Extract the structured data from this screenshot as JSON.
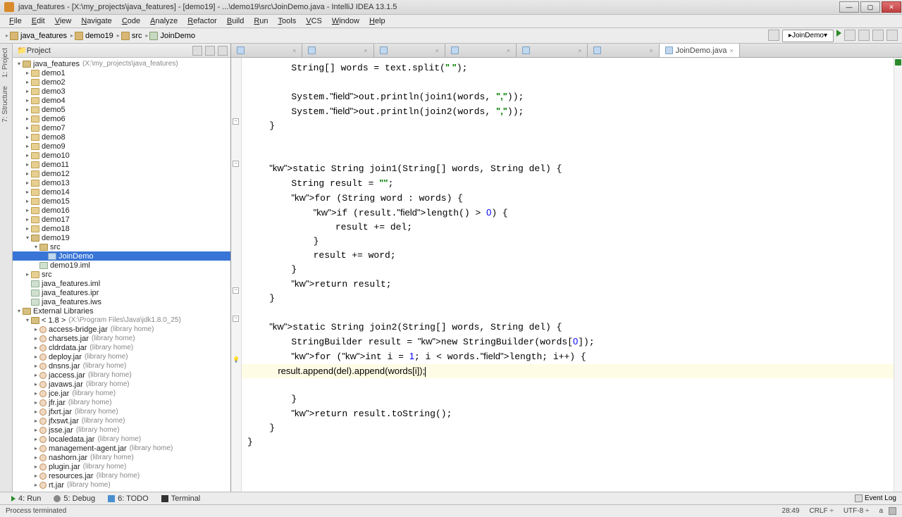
{
  "title": "java_features - [X:\\my_projects\\java_features] - [demo19] - ...\\demo19\\src\\JoinDemo.java - IntelliJ IDEA 13.1.5",
  "menu": [
    "File",
    "Edit",
    "View",
    "Navigate",
    "Code",
    "Analyze",
    "Refactor",
    "Build",
    "Run",
    "Tools",
    "VCS",
    "Window",
    "Help"
  ],
  "breadcrumb": [
    {
      "icon": "folder",
      "label": "java_features"
    },
    {
      "icon": "folder",
      "label": "demo19"
    },
    {
      "icon": "folder",
      "label": "src"
    },
    {
      "icon": "file",
      "label": "JoinDemo"
    }
  ],
  "run_config": "JoinDemo",
  "sidetabs": [
    "1: Project",
    "7: Structure"
  ],
  "project_header": "Project",
  "tree": {
    "root": {
      "label": "java_features",
      "extra": "(X:\\my_projects\\java_features)"
    },
    "demos": [
      "demo1",
      "demo2",
      "demo3",
      "demo4",
      "demo5",
      "demo6",
      "demo7",
      "demo8",
      "demo9",
      "demo10",
      "demo11",
      "demo12",
      "demo13",
      "demo14",
      "demo15",
      "demo16",
      "demo17",
      "demo18"
    ],
    "demo19": "demo19",
    "demo19_src": "src",
    "demo19_class": "JoinDemo",
    "demo19_iml": "demo19.iml",
    "proj_src": "src",
    "proj_files": [
      "java_features.iml",
      "java_features.ipr",
      "java_features.iws"
    ],
    "ext_lib": "External Libraries",
    "jdk": "< 1.8 >",
    "jdk_extra": "(X:\\Program Files\\Java\\jdk1.8.0_25)",
    "jars": [
      "access-bridge.jar",
      "charsets.jar",
      "cldrdata.jar",
      "deploy.jar",
      "dnsns.jar",
      "jaccess.jar",
      "javaws.jar",
      "jce.jar",
      "jfr.jar",
      "jfxrt.jar",
      "jfxswt.jar",
      "jsse.jar",
      "localedata.jar",
      "management-agent.jar",
      "nashorn.jar",
      "plugin.jar",
      "resources.jar",
      "rt.jar"
    ],
    "jar_hint": "(library home)"
  },
  "editor_tabs": {
    "inactive_count": 6,
    "active": "JoinDemo.java"
  },
  "code_lines": {
    "l1": "        String[] words = text.split(\" \");",
    "l2": "",
    "l3": "        System.out.println(join1(words, \",\"));",
    "l4": "        System.out.println(join2(words, \",\"));",
    "l5": "    }",
    "l6": "",
    "l7": "",
    "l8a": "    static String join1(String[] words, String del) {",
    "l9": "        String result = \"\";",
    "l10": "        for (String word : words) {",
    "l11": "            if (result.length() > 0) {",
    "l12": "                result += del;",
    "l13": "            }",
    "l14": "            result += word;",
    "l15": "        }",
    "l16": "        return result;",
    "l17": "    }",
    "l18": "",
    "l19": "    static String join2(String[] words, String del) {",
    "l20": "        StringBuilder result = new StringBuilder(words[0]);",
    "l21": "        for (int i = 1; i < words.length; i++) {",
    "l22": "            result.append(del).append(words[i]);",
    "l23": "        }",
    "l24": "        return result.toString();",
    "l25": "    }",
    "l26": "}"
  },
  "bottom_tabs": [
    "4: Run",
    "5: Debug",
    "6: TODO",
    "Terminal"
  ],
  "event_log": "Event Log",
  "status": {
    "left": "Process terminated",
    "pos": "28:49",
    "sep": "CRLF ÷",
    "enc": "UTF-8 ÷",
    "insert": "a"
  }
}
